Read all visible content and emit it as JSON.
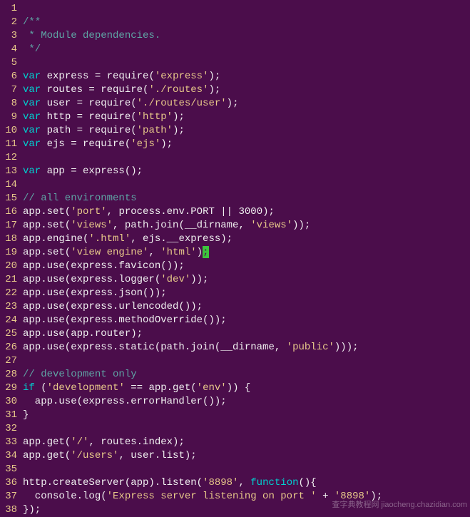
{
  "watermark": "查字典教程网\njiaocheng.chazidian.com",
  "cursor_line": 19,
  "lines": [
    {
      "n": 1,
      "tokens": []
    },
    {
      "n": 2,
      "tokens": [
        {
          "c": "comment",
          "t": "/**"
        }
      ]
    },
    {
      "n": 3,
      "tokens": [
        {
          "c": "comment",
          "t": " * Module dependencies."
        }
      ]
    },
    {
      "n": 4,
      "tokens": [
        {
          "c": "comment",
          "t": " */"
        }
      ]
    },
    {
      "n": 5,
      "tokens": []
    },
    {
      "n": 6,
      "tokens": [
        {
          "c": "kw",
          "t": "var"
        },
        {
          "c": "ident",
          "t": " express = require("
        },
        {
          "c": "str",
          "t": "'express'"
        },
        {
          "c": "ident",
          "t": ");"
        }
      ]
    },
    {
      "n": 7,
      "tokens": [
        {
          "c": "kw",
          "t": "var"
        },
        {
          "c": "ident",
          "t": " routes = require("
        },
        {
          "c": "str",
          "t": "'./routes'"
        },
        {
          "c": "ident",
          "t": ");"
        }
      ]
    },
    {
      "n": 8,
      "tokens": [
        {
          "c": "kw",
          "t": "var"
        },
        {
          "c": "ident",
          "t": " user = require("
        },
        {
          "c": "str",
          "t": "'./routes/user'"
        },
        {
          "c": "ident",
          "t": ");"
        }
      ]
    },
    {
      "n": 9,
      "tokens": [
        {
          "c": "kw",
          "t": "var"
        },
        {
          "c": "ident",
          "t": " http = require("
        },
        {
          "c": "str",
          "t": "'http'"
        },
        {
          "c": "ident",
          "t": ");"
        }
      ]
    },
    {
      "n": 10,
      "tokens": [
        {
          "c": "kw",
          "t": "var"
        },
        {
          "c": "ident",
          "t": " path = require("
        },
        {
          "c": "str",
          "t": "'path'"
        },
        {
          "c": "ident",
          "t": ");"
        }
      ]
    },
    {
      "n": 11,
      "tokens": [
        {
          "c": "kw",
          "t": "var"
        },
        {
          "c": "ident",
          "t": " ejs = require("
        },
        {
          "c": "str",
          "t": "'ejs'"
        },
        {
          "c": "ident",
          "t": ");"
        }
      ]
    },
    {
      "n": 12,
      "tokens": []
    },
    {
      "n": 13,
      "tokens": [
        {
          "c": "kw",
          "t": "var"
        },
        {
          "c": "ident",
          "t": " app = express();"
        }
      ]
    },
    {
      "n": 14,
      "tokens": []
    },
    {
      "n": 15,
      "tokens": [
        {
          "c": "comment",
          "t": "// all environments"
        }
      ]
    },
    {
      "n": 16,
      "tokens": [
        {
          "c": "ident",
          "t": "app.set("
        },
        {
          "c": "str",
          "t": "'port'"
        },
        {
          "c": "ident",
          "t": ", process.env.PORT || "
        },
        {
          "c": "num",
          "t": "3000"
        },
        {
          "c": "ident",
          "t": ");"
        }
      ]
    },
    {
      "n": 17,
      "tokens": [
        {
          "c": "ident",
          "t": "app.set("
        },
        {
          "c": "str",
          "t": "'views'"
        },
        {
          "c": "ident",
          "t": ", path.join(__dirname, "
        },
        {
          "c": "str",
          "t": "'views'"
        },
        {
          "c": "ident",
          "t": "));"
        }
      ]
    },
    {
      "n": 18,
      "tokens": [
        {
          "c": "ident",
          "t": "app.engine("
        },
        {
          "c": "str",
          "t": "'.html'"
        },
        {
          "c": "ident",
          "t": ", ejs.__express);"
        }
      ]
    },
    {
      "n": 19,
      "tokens": [
        {
          "c": "ident",
          "t": "app.set("
        },
        {
          "c": "str",
          "t": "'view engine'"
        },
        {
          "c": "ident",
          "t": ", "
        },
        {
          "c": "str",
          "t": "'html'"
        },
        {
          "c": "ident",
          "t": ")"
        },
        {
          "c": "cursor",
          "t": ";"
        }
      ]
    },
    {
      "n": 20,
      "tokens": [
        {
          "c": "ident",
          "t": "app.use(express.favicon());"
        }
      ]
    },
    {
      "n": 21,
      "tokens": [
        {
          "c": "ident",
          "t": "app.use(express.logger("
        },
        {
          "c": "str",
          "t": "'dev'"
        },
        {
          "c": "ident",
          "t": "));"
        }
      ]
    },
    {
      "n": 22,
      "tokens": [
        {
          "c": "ident",
          "t": "app.use(express.json());"
        }
      ]
    },
    {
      "n": 23,
      "tokens": [
        {
          "c": "ident",
          "t": "app.use(express.urlencoded());"
        }
      ]
    },
    {
      "n": 24,
      "tokens": [
        {
          "c": "ident",
          "t": "app.use(express.methodOverride());"
        }
      ]
    },
    {
      "n": 25,
      "tokens": [
        {
          "c": "ident",
          "t": "app.use(app.router);"
        }
      ]
    },
    {
      "n": 26,
      "tokens": [
        {
          "c": "ident",
          "t": "app.use(express.static(path.join(__dirname, "
        },
        {
          "c": "str",
          "t": "'public'"
        },
        {
          "c": "ident",
          "t": ")));"
        }
      ]
    },
    {
      "n": 27,
      "tokens": []
    },
    {
      "n": 28,
      "tokens": [
        {
          "c": "comment",
          "t": "// development only"
        }
      ]
    },
    {
      "n": 29,
      "tokens": [
        {
          "c": "kw",
          "t": "if"
        },
        {
          "c": "ident",
          "t": " ("
        },
        {
          "c": "str",
          "t": "'development'"
        },
        {
          "c": "ident",
          "t": " == app.get("
        },
        {
          "c": "str",
          "t": "'env'"
        },
        {
          "c": "ident",
          "t": ")) {"
        }
      ]
    },
    {
      "n": 30,
      "tokens": [
        {
          "c": "ident",
          "t": "  app.use(express.errorHandler());"
        }
      ]
    },
    {
      "n": 31,
      "tokens": [
        {
          "c": "ident",
          "t": "}"
        }
      ]
    },
    {
      "n": 32,
      "tokens": []
    },
    {
      "n": 33,
      "tokens": [
        {
          "c": "ident",
          "t": "app.get("
        },
        {
          "c": "str",
          "t": "'/'"
        },
        {
          "c": "ident",
          "t": ", routes.index);"
        }
      ]
    },
    {
      "n": 34,
      "tokens": [
        {
          "c": "ident",
          "t": "app.get("
        },
        {
          "c": "str",
          "t": "'/users'"
        },
        {
          "c": "ident",
          "t": ", user.list);"
        }
      ]
    },
    {
      "n": 35,
      "tokens": []
    },
    {
      "n": 36,
      "tokens": [
        {
          "c": "ident",
          "t": "http.createServer(app).listen("
        },
        {
          "c": "str",
          "t": "'8898'"
        },
        {
          "c": "ident",
          "t": ", "
        },
        {
          "c": "kw",
          "t": "function"
        },
        {
          "c": "ident",
          "t": "(){"
        }
      ]
    },
    {
      "n": 37,
      "tokens": [
        {
          "c": "ident",
          "t": "  console.log("
        },
        {
          "c": "str",
          "t": "'Express server listening on port '"
        },
        {
          "c": "ident",
          "t": " + "
        },
        {
          "c": "str",
          "t": "'8898'"
        },
        {
          "c": "ident",
          "t": ");"
        }
      ]
    },
    {
      "n": 38,
      "tokens": [
        {
          "c": "ident",
          "t": "});"
        }
      ]
    }
  ]
}
